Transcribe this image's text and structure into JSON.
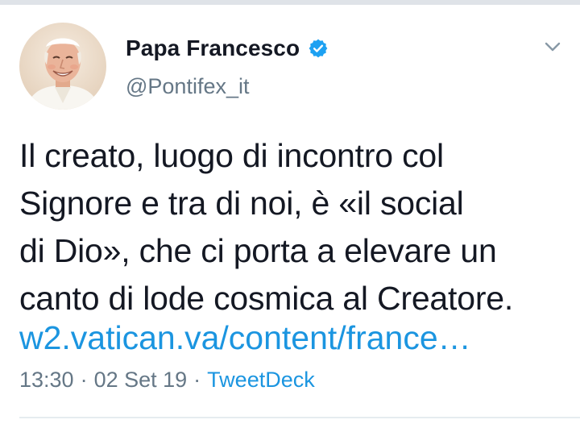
{
  "colors": {
    "text": "#141823",
    "secondary": "#657786",
    "link": "#1b95e0",
    "verified": "#1da1f2",
    "divider": "#e6ecf0"
  },
  "author": {
    "name": "Papa Francesco",
    "handle": "@Pontifex_it",
    "verified": true,
    "avatar_icon": "avatar-photo",
    "verified_icon": "verified-badge-icon",
    "menu_icon": "chevron-down-icon"
  },
  "tweet": {
    "lines": [
      "Il creato, luogo di incontro col",
      "Signore e tra di noi, è «il social",
      "di Dio», che ci porta a elevare un",
      "canto di lode cosmica al Creatore."
    ],
    "link": "w2.vatican.va/content/france…"
  },
  "meta": {
    "time": "13:30",
    "separator": "·",
    "date": "02 Set 19",
    "source": "TweetDeck"
  }
}
